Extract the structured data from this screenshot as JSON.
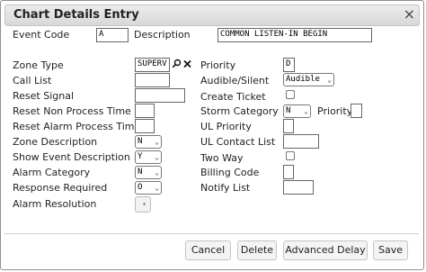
{
  "dialog": {
    "title": "Chart Details Entry",
    "close_glyph": "×"
  },
  "fields": {
    "event_code": {
      "label": "Event Code",
      "value": "A"
    },
    "description": {
      "label": "Description",
      "value": "COMMON LISTEN-IN BEGIN"
    },
    "zone_type": {
      "label": "Zone Type",
      "value": "SUPERV"
    },
    "priority": {
      "label": "Priority",
      "value": "D"
    },
    "call_list": {
      "label": "Call List",
      "value": ""
    },
    "audible_silent": {
      "label": "Audible/Silent",
      "value": "Audible"
    },
    "reset_signal": {
      "label": "Reset Signal",
      "value": ""
    },
    "create_ticket": {
      "label": "Create Ticket"
    },
    "reset_non_process_time": {
      "label": "Reset Non Process Time",
      "value": ""
    },
    "storm_category": {
      "label": "Storm Category",
      "value": "N"
    },
    "storm_priority": {
      "label": "Priority",
      "value": ""
    },
    "reset_alarm_process_time": {
      "label": "Reset Alarm Process Time",
      "value": ""
    },
    "ul_priority": {
      "label": "UL Priority",
      "value": ""
    },
    "zone_description": {
      "label": "Zone Description",
      "value": "N"
    },
    "ul_contact_list": {
      "label": "UL Contact List",
      "value": ""
    },
    "show_event_description": {
      "label": "Show Event Description",
      "value": "Y"
    },
    "two_way": {
      "label": "Two Way"
    },
    "alarm_category": {
      "label": "Alarm Category",
      "value": "N"
    },
    "billing_code": {
      "label": "Billing Code",
      "value": ""
    },
    "response_required": {
      "label": "Response Required",
      "value": "O"
    },
    "notify_list": {
      "label": "Notify List",
      "value": ""
    },
    "alarm_resolution": {
      "label": "Alarm Resolution",
      "value": ""
    }
  },
  "icons": {
    "search": "search-icon",
    "clear": "clear-icon"
  },
  "buttons": {
    "cancel": "Cancel",
    "delete": "Delete",
    "advanced_delay": "Advanced Delay",
    "save": "Save"
  }
}
